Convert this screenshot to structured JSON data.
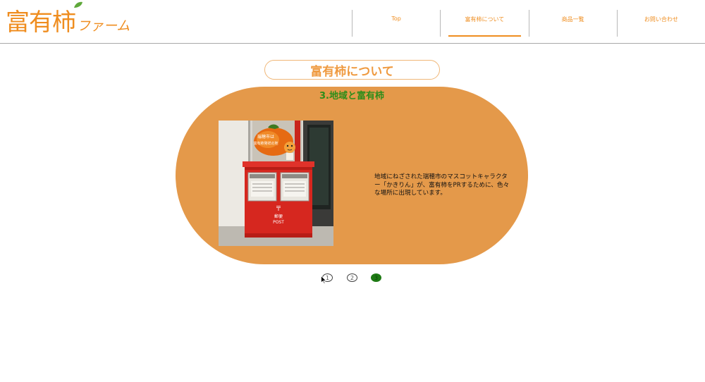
{
  "header": {
    "logo_kanji": "富有柿",
    "logo_kana": "ファーム",
    "nav": [
      {
        "label": "Top",
        "active": false
      },
      {
        "label": "富有柿について",
        "active": true
      },
      {
        "label": "商品一覧",
        "active": false
      },
      {
        "label": "お問い合わせ",
        "active": false
      }
    ]
  },
  "section_title": "富有柿について",
  "slide": {
    "heading": "3.地域と富有柿",
    "text": "地域にねざされた瑞穂市のマスコットキャラクター「かきりん」が、富有柿をPRするために、色々な場所に出現しています。",
    "photo": {
      "sign_line1": "瑞穂市は",
      "sign_line2": "富有柿発祥の地",
      "postbox_mark": "〒",
      "postbox_label1": "郵便",
      "postbox_label2": "POST"
    }
  },
  "pagination": [
    {
      "label": "1",
      "active": false
    },
    {
      "label": "2",
      "active": false
    },
    {
      "label": "3",
      "active": true
    }
  ],
  "colors": {
    "accent": "#ef8d1f",
    "slide_bg": "#e4994a",
    "heading_green": "#2e8d1a"
  }
}
